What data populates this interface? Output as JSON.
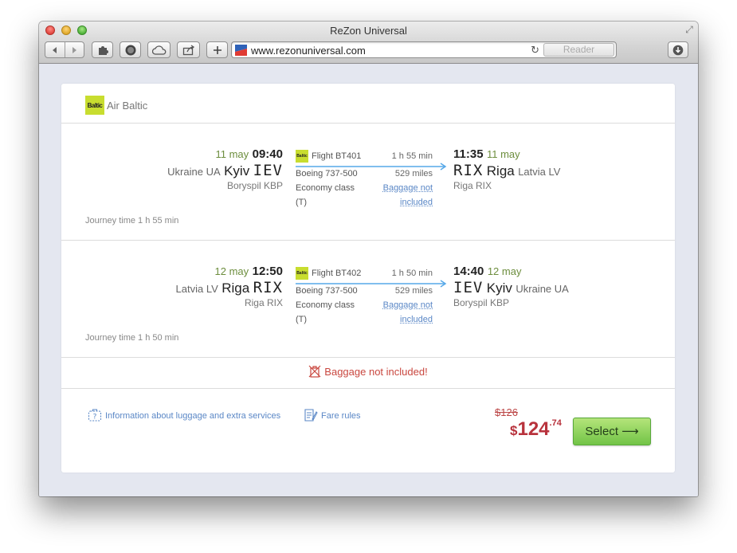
{
  "window": {
    "title": "ReZon Universal",
    "url": "www.rezonuniversal.com",
    "reader_label": "Reader"
  },
  "airline": {
    "logo_text": "Baltic",
    "name": "Air Baltic"
  },
  "segments": [
    {
      "dep_date": "11 may",
      "dep_time": "09:40",
      "dep_country": "Ukraine UA",
      "dep_city": "Kyiv",
      "dep_code": "IEV",
      "dep_airport": "Boryspil KBP",
      "flight": "Flight BT401",
      "aircraft": "Boeing 737-500",
      "class": "Economy class",
      "fare_code": "(T)",
      "duration": "1 h 55 min",
      "distance": "529 miles",
      "baggage_1": "Baggage not",
      "baggage_2": "included",
      "arr_time": "11:35",
      "arr_date": "11 may",
      "arr_code": "RIX",
      "arr_city": "Riga",
      "arr_country": "Latvia LV",
      "arr_airport": "Riga RIX",
      "journey_label": "Journey time",
      "journey_value": "1 h 55 min"
    },
    {
      "dep_date": "12 may",
      "dep_time": "12:50",
      "dep_country": "Latvia LV",
      "dep_city": "Riga",
      "dep_code": "RIX",
      "dep_airport": "Riga RIX",
      "flight": "Flight BT402",
      "aircraft": "Boeing 737-500",
      "class": "Economy class",
      "fare_code": "(T)",
      "duration": "1 h 50 min",
      "distance": "529 miles",
      "baggage_1": "Baggage not",
      "baggage_2": "included",
      "arr_time": "14:40",
      "arr_date": "12 may",
      "arr_code": "IEV",
      "arr_city": "Kyiv",
      "arr_country": "Ukraine UA",
      "arr_airport": "Boryspil KBP",
      "journey_label": "Journey time",
      "journey_value": "1 h 50 min"
    }
  ],
  "baggage_warning": "Baggage not included!",
  "footer": {
    "luggage_info": "Information about luggage and extra services",
    "fare_rules": "Fare rules"
  },
  "price": {
    "old": "$126",
    "currency": "$",
    "main": "124",
    "cents": ".74"
  },
  "select_label": "Select ⟶",
  "colors": {
    "accent_green": "#72c447",
    "price_red": "#b8323c",
    "link_blue": "#5a87c6",
    "airline_lime": "#c8dd2f"
  }
}
